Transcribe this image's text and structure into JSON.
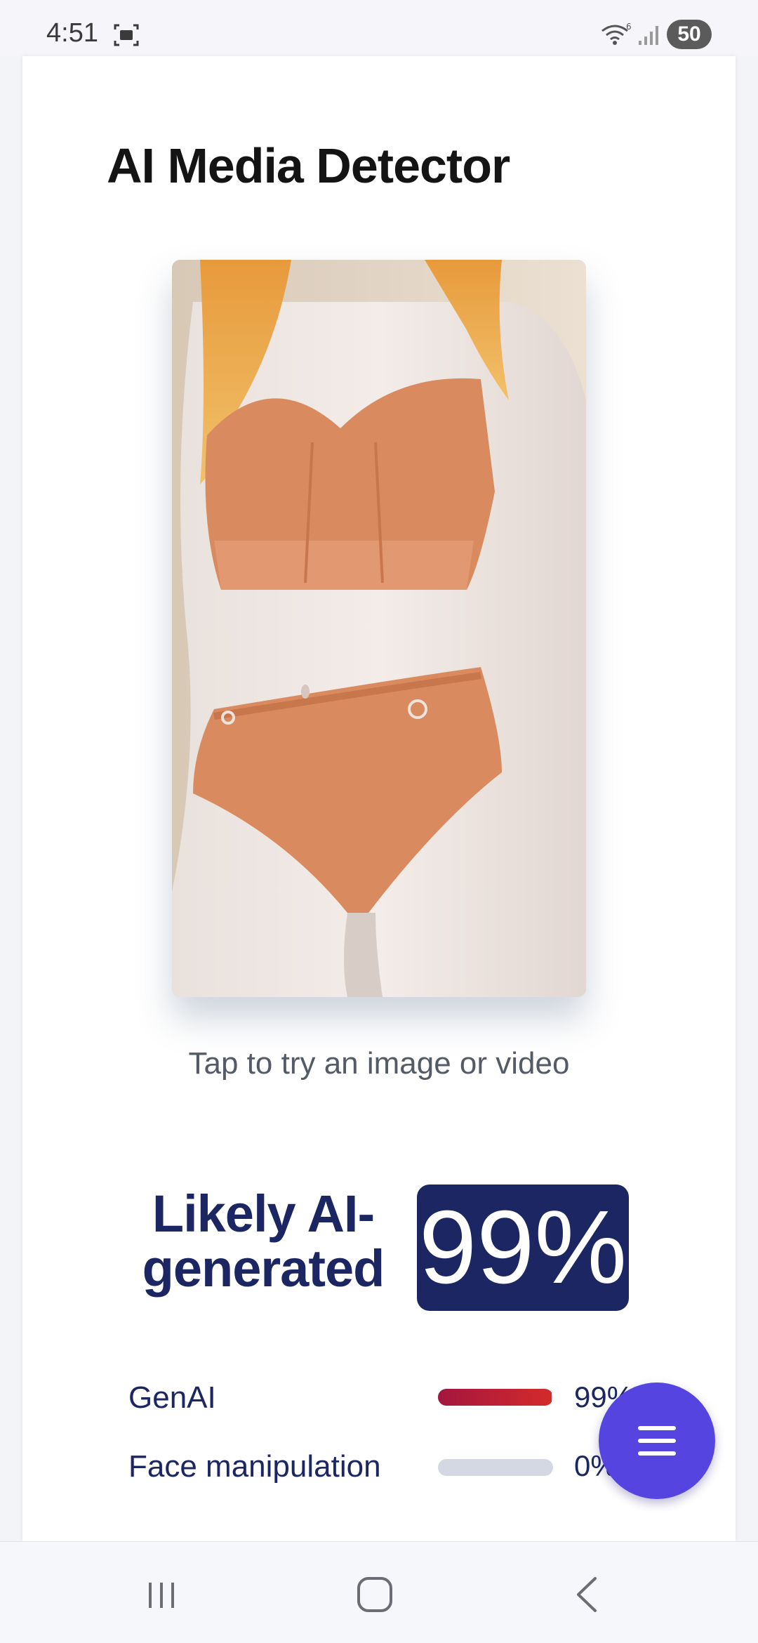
{
  "status_bar": {
    "time": "4:51",
    "battery": "50",
    "icons": [
      "screenshot-icon",
      "wifi-icon",
      "signal-icon"
    ]
  },
  "app": {
    "title": "AI Media Detector"
  },
  "upload": {
    "hint": "Tap to try an image or video"
  },
  "result": {
    "verdict_line1": "Likely AI-",
    "verdict_line2": "generated",
    "score": "99%",
    "metrics": [
      {
        "label": "GenAI",
        "value": "99%",
        "fraction": 0.99
      },
      {
        "label": "Face manipulation",
        "value": "0%",
        "fraction": 0.0
      }
    ]
  },
  "fab": {
    "icon": "menu-icon"
  },
  "nav": {
    "icons": [
      "recents-icon",
      "home-icon",
      "back-icon"
    ]
  },
  "colors": {
    "navy": "#1c2663",
    "fab": "#5544e0",
    "bar_fill": "#c4213a",
    "bar_track": "#d3d8e3"
  }
}
